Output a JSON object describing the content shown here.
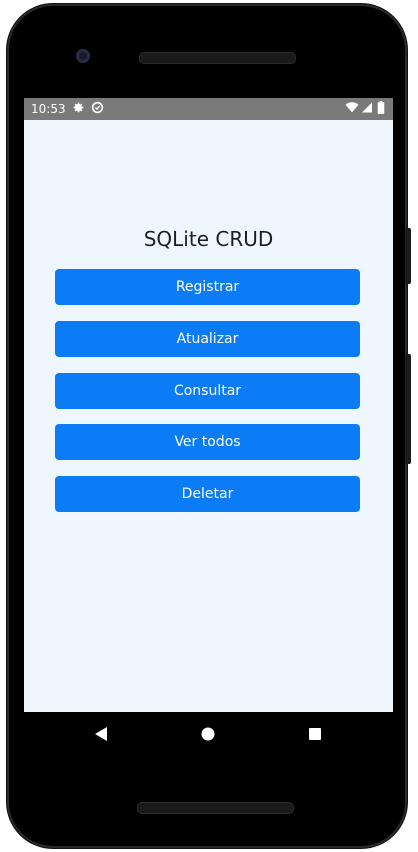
{
  "status_bar": {
    "time": "10:53",
    "icons": [
      "gear-icon",
      "sync-icon",
      "wifi-icon",
      "signal-icon",
      "battery-icon"
    ]
  },
  "app": {
    "title": "SQLite CRUD",
    "buttons": [
      "Registrar",
      "Atualizar",
      "Consultar",
      "Ver todos",
      "Deletar"
    ]
  },
  "nav_bar": {
    "icons": [
      "back-icon",
      "home-icon",
      "recents-icon"
    ]
  },
  "colors": {
    "button_bg": "#0b7cf5",
    "screen_bg": "#eef7fe",
    "status_bar_bg": "#7a7a7a"
  }
}
